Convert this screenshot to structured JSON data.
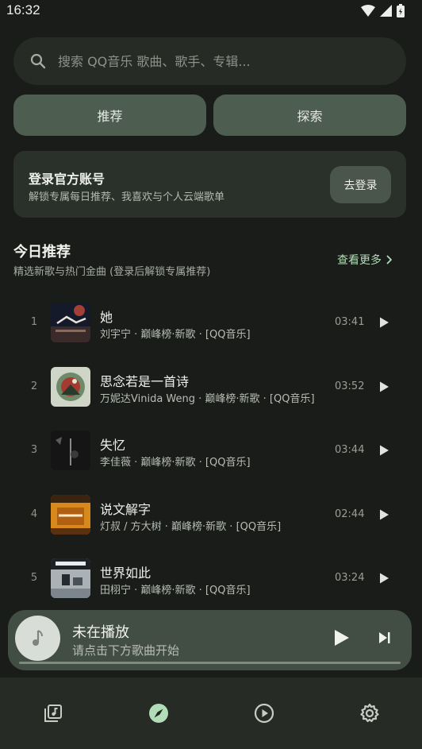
{
  "status_bar": {
    "time": "16:32"
  },
  "search": {
    "placeholder": "搜索 QQ音乐 歌曲、歌手、专辑..."
  },
  "tabs": [
    {
      "label": "推荐"
    },
    {
      "label": "探索"
    }
  ],
  "login_card": {
    "title": "登录官方账号",
    "subtitle": "解锁专属每日推荐、我喜欢与个人云端歌单",
    "button": "去登录"
  },
  "section": {
    "title": "今日推荐",
    "subtitle": "精选新歌与热门金曲 (登录后解锁专属推荐)",
    "more": "查看更多"
  },
  "songs": [
    {
      "index": "1",
      "title": "她",
      "meta": "刘宇宁 · 巅峰榜·新歌 · [QQ音乐]",
      "duration": "03:41"
    },
    {
      "index": "2",
      "title": "思念若是一首诗",
      "meta": "万妮达Vinida Weng · 巅峰榜·新歌 · [QQ音乐]",
      "duration": "03:52"
    },
    {
      "index": "3",
      "title": "失忆",
      "meta": "李佳薇 · 巅峰榜·新歌 · [QQ音乐]",
      "duration": "03:44"
    },
    {
      "index": "4",
      "title": "说文解字",
      "meta": "灯叔 / 方大树 · 巅峰榜·新歌 · [QQ音乐]",
      "duration": "02:44"
    },
    {
      "index": "5",
      "title": "世界如此",
      "meta": "田栩宁 · 巅峰榜·新歌 · [QQ音乐]",
      "duration": "03:24"
    }
  ],
  "player": {
    "title": "未在播放",
    "subtitle": "请点击下方歌曲开始",
    "progress": 0
  },
  "nav": {
    "items": [
      {
        "icon": "music-library-icon"
      },
      {
        "icon": "compass-icon",
        "active": true
      },
      {
        "icon": "play-circle-icon"
      },
      {
        "icon": "gear-icon"
      }
    ]
  },
  "colors": {
    "background": "#191c19",
    "accent": "#b3dcb8",
    "tab": "#4d5d50",
    "player": "#424d44"
  }
}
